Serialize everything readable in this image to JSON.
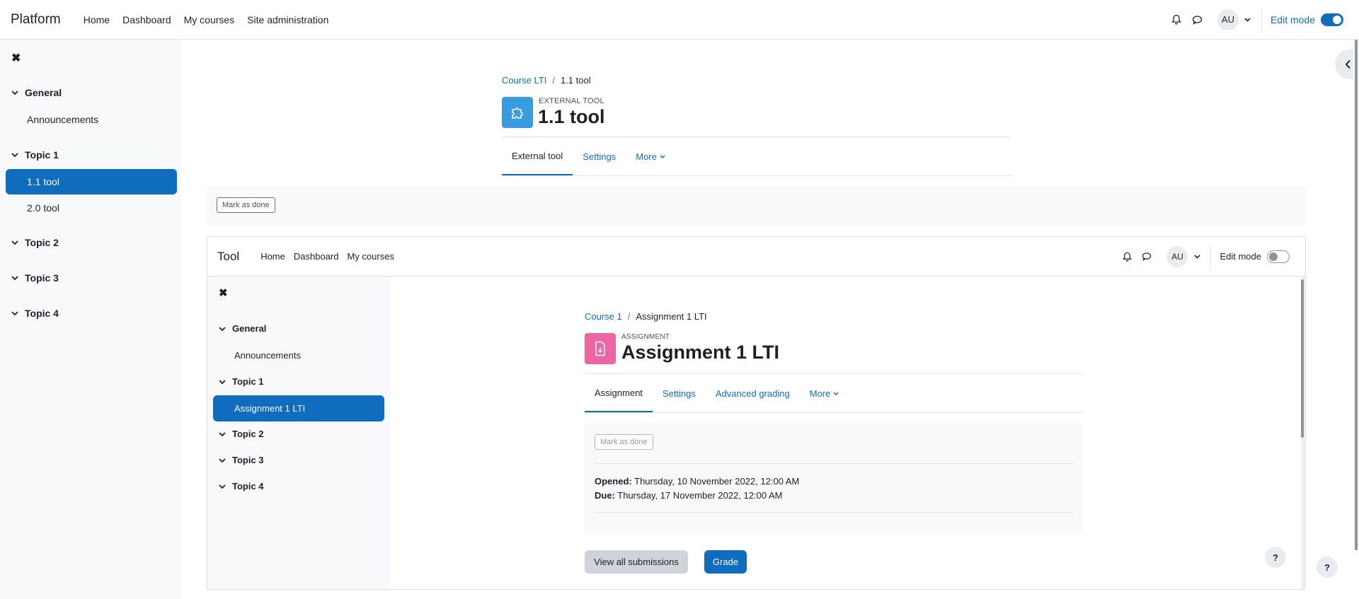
{
  "navbar": {
    "brand": "Platform",
    "links": [
      "Home",
      "Dashboard",
      "My courses",
      "Site administration"
    ],
    "avatar": "AU",
    "edit_mode_label": "Edit mode",
    "edit_mode_on": true
  },
  "course_index": {
    "sections": [
      {
        "title": "General",
        "items": [
          "Announcements"
        ]
      },
      {
        "title": "Topic 1",
        "items": [
          "1.1 tool",
          "2.0 tool"
        ]
      },
      {
        "title": "Topic 2",
        "items": []
      },
      {
        "title": "Topic 3",
        "items": []
      },
      {
        "title": "Topic 4",
        "items": []
      }
    ],
    "active_item": "1.1 tool"
  },
  "page": {
    "breadcrumb": [
      "Course LTI",
      "1.1 tool"
    ],
    "activity_type": "EXTERNAL TOOL",
    "title": "1.1 tool",
    "tabs": [
      "External tool",
      "Settings",
      "More"
    ],
    "active_tab": "External tool",
    "mark_done": "Mark as done"
  },
  "embedded": {
    "navbar": {
      "brand": "Tool",
      "links": [
        "Home",
        "Dashboard",
        "My courses"
      ],
      "avatar": "AU",
      "edit_mode_label": "Edit mode",
      "edit_mode_on": false
    },
    "course_index": {
      "sections": [
        {
          "title": "General",
          "items": [
            "Announcements"
          ]
        },
        {
          "title": "Topic 1",
          "items": [
            "Assignment 1 LTI"
          ]
        },
        {
          "title": "Topic 2",
          "items": []
        },
        {
          "title": "Topic 3",
          "items": []
        },
        {
          "title": "Topic 4",
          "items": []
        }
      ],
      "active_item": "Assignment 1 LTI"
    },
    "page": {
      "breadcrumb": [
        "Course 1",
        "Assignment 1 LTI"
      ],
      "activity_type": "ASSIGNMENT",
      "title": "Assignment 1 LTI",
      "tabs": [
        "Assignment",
        "Settings",
        "Advanced grading",
        "More"
      ],
      "active_tab": "Assignment",
      "mark_done": "Mark as done",
      "opened_label": "Opened:",
      "opened_value": "Thursday, 10 November 2022, 12:00 AM",
      "due_label": "Due:",
      "due_value": "Thursday, 17 November 2022, 12:00 AM",
      "view_submissions": "View all submissions",
      "grade": "Grade",
      "help": "?"
    }
  },
  "help": "?",
  "colors": {
    "accent": "#0f6cbf",
    "lti_icon_bg": "#399be2",
    "assign_icon_bg": "#eb66a2"
  }
}
